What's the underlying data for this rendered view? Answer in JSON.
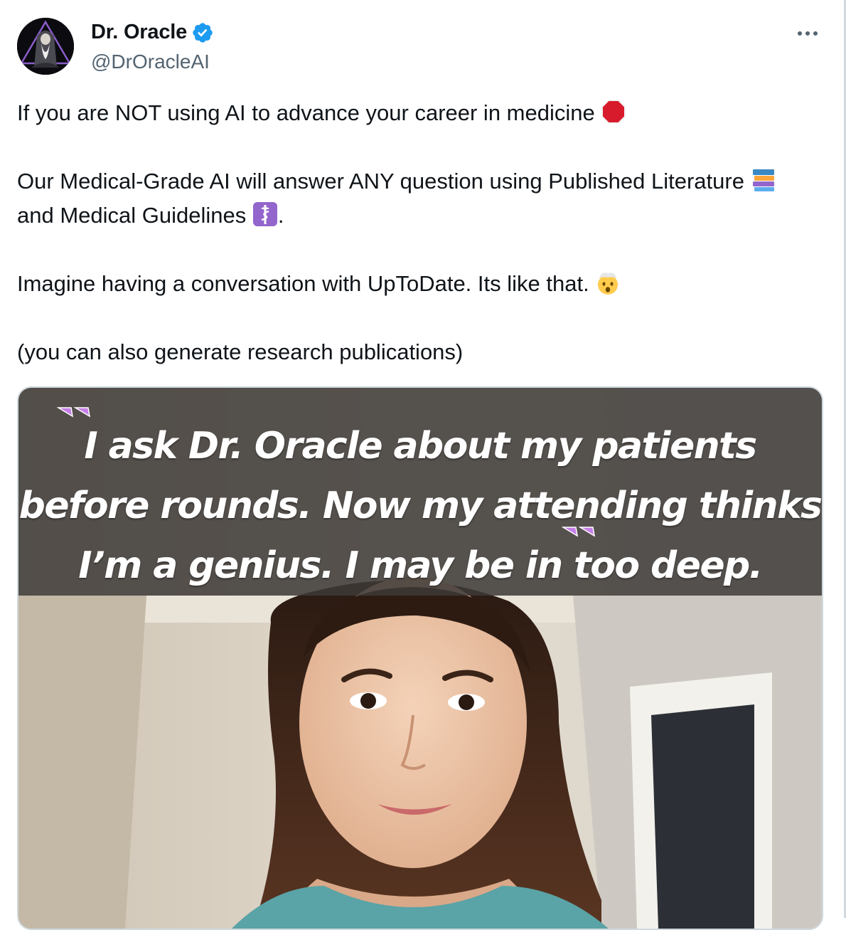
{
  "author": {
    "display_name": "Dr. Oracle",
    "handle": "@DrOracleAI",
    "verified": true,
    "avatar_icon": "wizard-avatar-icon"
  },
  "tweet": {
    "line1": "If you are NOT using AI to advance your career in medicine",
    "line1_emoji": "stop-sign-icon",
    "line2_part1": "Our Medical-Grade AI will answer ANY question using Published Literature",
    "line2_emoji1": "books-icon",
    "line2_part2": "and Medical Guidelines",
    "line2_emoji2": "medical-symbol-icon",
    "line2_end": ".",
    "line3": "Imagine having a conversation with UpToDate. Its like that.",
    "line3_emoji": "exploding-head-icon",
    "line4": "(you can also generate research publications)"
  },
  "media": {
    "quote": "I ask Dr. Oracle about my patients before rounds. Now my attending thinks I’m a genius. I may be in too deep.",
    "quote_mark_color": "#c67ee8"
  },
  "colors": {
    "verified": "#1d9bf0",
    "text": "#0f1419",
    "secondary": "#536471"
  }
}
